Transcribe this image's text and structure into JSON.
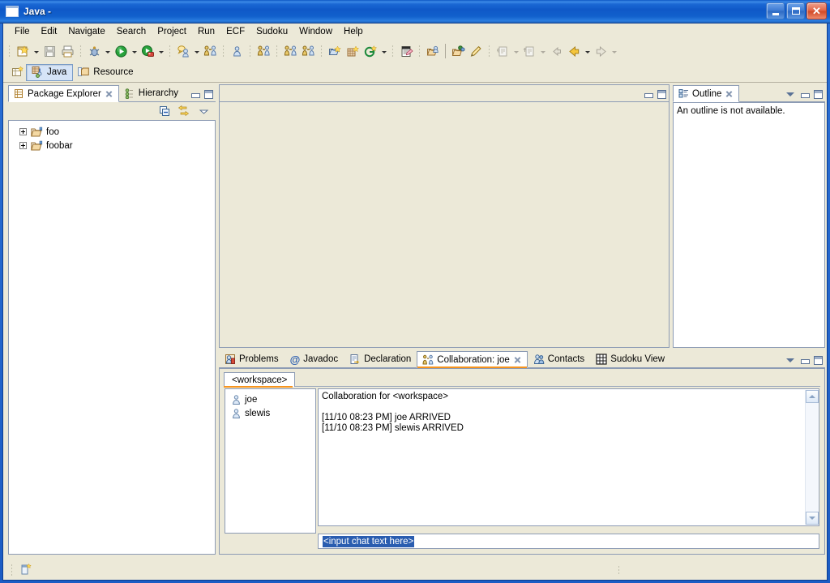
{
  "window": {
    "title": "Java -",
    "icon": "window-icon",
    "minimize_label": "Minimize",
    "maximize_label": "Maximize",
    "close_label": "Close"
  },
  "menubar": {
    "items": [
      {
        "label": "File"
      },
      {
        "label": "Edit"
      },
      {
        "label": "Navigate"
      },
      {
        "label": "Search"
      },
      {
        "label": "Project"
      },
      {
        "label": "Run"
      },
      {
        "label": "ECF"
      },
      {
        "label": "Sudoku"
      },
      {
        "label": "Window"
      },
      {
        "label": "Help"
      }
    ]
  },
  "toolbar": {
    "groups": [
      {
        "buttons": [
          {
            "icon": "new-wizard-icon",
            "dropdown": true
          },
          {
            "icon": "save-icon",
            "dropdown": false
          },
          {
            "icon": "print-icon",
            "dropdown": false
          }
        ]
      },
      {
        "buttons": [
          {
            "icon": "debug-icon",
            "dropdown": true
          },
          {
            "icon": "run-icon",
            "dropdown": true
          },
          {
            "icon": "run-external-tools-icon",
            "dropdown": true
          }
        ]
      },
      {
        "buttons": [
          {
            "icon": "ecf-chat-icon",
            "dropdown": true
          },
          {
            "icon": "ecf-collaboration-icon",
            "dropdown": false
          }
        ]
      },
      {
        "buttons": [
          {
            "icon": "ecf-user-icon",
            "dropdown": false
          }
        ]
      },
      {
        "buttons": [
          {
            "icon": "ecf-connect-icon",
            "dropdown": false
          }
        ]
      },
      {
        "buttons": [
          {
            "icon": "ecf-connect2-icon",
            "dropdown": false
          }
        ]
      },
      {
        "buttons": [
          {
            "icon": "ecf-connect3-icon",
            "dropdown": false
          }
        ]
      },
      {
        "buttons": [
          {
            "icon": "new-java-project-icon",
            "dropdown": false
          },
          {
            "icon": "new-package-icon",
            "dropdown": false
          },
          {
            "icon": "new-class-icon",
            "dropdown": true
          }
        ]
      },
      {
        "buttons": [
          {
            "icon": "open-type-icon",
            "dropdown": false
          }
        ]
      },
      {
        "buttons": [
          {
            "icon": "open-resource-icon",
            "dropdown": false
          },
          {
            "icon": "search-folder-icon",
            "dropdown": false
          },
          {
            "icon": "pencil-icon",
            "dropdown": false
          }
        ]
      },
      {
        "buttons": [
          {
            "icon": "next-annotation-icon",
            "dropdown": true
          },
          {
            "icon": "previous-annotation-icon",
            "dropdown": true
          },
          {
            "icon": "back-small-icon",
            "dropdown": false
          },
          {
            "icon": "back-icon",
            "dropdown": true
          },
          {
            "icon": "forward-icon",
            "dropdown": true
          }
        ]
      }
    ]
  },
  "perspective_bar": {
    "open_perspective_icon": "open-perspective-icon",
    "perspectives": [
      {
        "label": "Java",
        "icon": "java-perspective-icon",
        "active": true
      },
      {
        "label": "Resource",
        "icon": "resource-perspective-icon",
        "active": false
      }
    ]
  },
  "package_explorer": {
    "tabs": [
      {
        "label": "Package Explorer",
        "icon": "package-explorer-icon",
        "active": true,
        "closable": true
      },
      {
        "label": "Hierarchy",
        "icon": "hierarchy-icon",
        "active": false,
        "closable": false
      }
    ],
    "toolbar": [
      {
        "icon": "collapse-all-icon"
      },
      {
        "icon": "link-with-editor-icon"
      },
      {
        "icon": "view-menu-icon"
      }
    ],
    "controls": [
      {
        "icon": "minimize-icon"
      },
      {
        "icon": "maximize-icon"
      }
    ],
    "tree": [
      {
        "label": "foo",
        "icon": "project-folder-icon",
        "expandable": true
      },
      {
        "label": "foobar",
        "icon": "project-folder-icon",
        "expandable": true
      }
    ]
  },
  "editor_area": {
    "controls": [
      {
        "icon": "minimize-icon"
      },
      {
        "icon": "maximize-icon"
      }
    ]
  },
  "outline": {
    "tabs": [
      {
        "label": "Outline",
        "icon": "outline-icon",
        "active": true,
        "closable": true
      }
    ],
    "controls": [
      {
        "icon": "view-menu-icon"
      },
      {
        "icon": "minimize-icon"
      },
      {
        "icon": "maximize-icon"
      }
    ],
    "message": "An outline is not available."
  },
  "bottom_stack": {
    "tabs": [
      {
        "label": "Problems",
        "icon": "problems-icon",
        "active": false,
        "closable": false
      },
      {
        "label": "Javadoc",
        "icon": "javadoc-icon",
        "active": false,
        "closable": false
      },
      {
        "label": "Declaration",
        "icon": "declaration-icon",
        "active": false,
        "closable": false
      },
      {
        "label": "Collaboration: joe",
        "icon": "collaboration-icon",
        "active": true,
        "closable": true
      },
      {
        "label": "Contacts",
        "icon": "contacts-icon",
        "active": false,
        "closable": false
      },
      {
        "label": "Sudoku View",
        "icon": "sudoku-icon",
        "active": false,
        "closable": false
      }
    ],
    "controls": [
      {
        "icon": "view-menu-icon"
      },
      {
        "icon": "minimize-icon"
      },
      {
        "icon": "maximize-icon"
      }
    ]
  },
  "collaboration": {
    "session_tab": "<workspace>",
    "users": [
      {
        "name": "joe",
        "icon": "user-icon"
      },
      {
        "name": "slewis",
        "icon": "user-icon"
      }
    ],
    "log_header": "Collaboration for <workspace>",
    "log_lines": [
      "[11/10 08:23 PM] joe ARRIVED",
      "[11/10 08:23 PM] slewis ARRIVED"
    ],
    "input_value": "<input chat text here>",
    "input_placeholder": "<input chat text here>",
    "scroll_up_label": "Scroll up",
    "scroll_down_label": "Scroll down"
  },
  "statusbar": {
    "icon": "editor-status-icon"
  }
}
